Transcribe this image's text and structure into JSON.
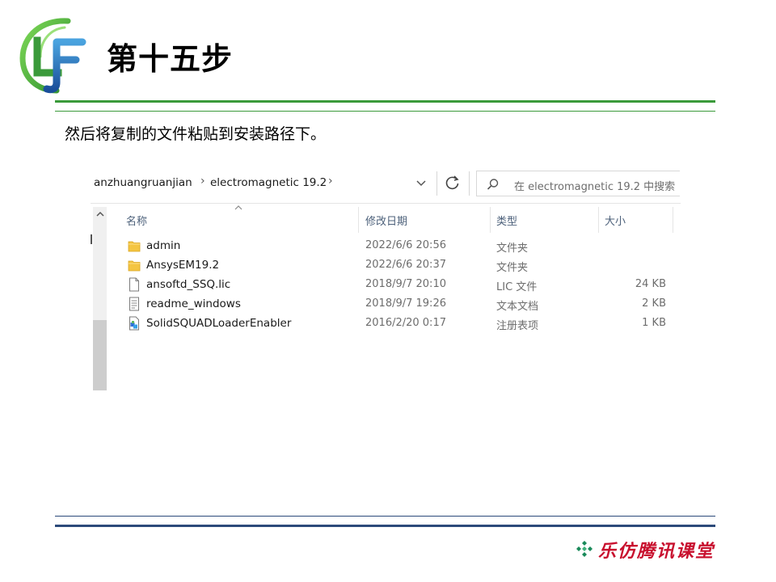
{
  "slide": {
    "logo_text": "LF",
    "title": "第十五步",
    "subtitle": "然后将复制的文件粘贴到安装路径下。"
  },
  "explorer": {
    "breadcrumbs": [
      "anzhuangruanjian",
      "electromagnetic 19.2"
    ],
    "search_placeholder": "在 electromagnetic 19.2 中搜索",
    "columns": {
      "name": "名称",
      "modified": "修改日期",
      "type": "类型",
      "size": "大小"
    },
    "files": [
      {
        "icon": "folder-icon",
        "name": "admin",
        "modified": "2022/6/6 20:56",
        "type": "文件夹",
        "size": ""
      },
      {
        "icon": "folder-icon",
        "name": "AnsysEM19.2",
        "modified": "2022/6/6 20:37",
        "type": "文件夹",
        "size": ""
      },
      {
        "icon": "document-icon",
        "name": "ansoftd_SSQ.lic",
        "modified": "2018/9/7 20:10",
        "type": "LIC 文件",
        "size": "24 KB"
      },
      {
        "icon": "text-document-icon",
        "name": "readme_windows",
        "modified": "2018/9/7 19:26",
        "type": "文本文档",
        "size": "2 KB"
      },
      {
        "icon": "registry-file-icon",
        "name": "SolidSQUADLoaderEnabler",
        "modified": "2016/2/20 0:17",
        "type": "注册表项",
        "size": "1 KB"
      }
    ]
  },
  "footer": {
    "brand": "乐仿腾讯课堂"
  },
  "colors": {
    "green_rule": "#3a9a3a",
    "blue_rule": "#2c4a7a",
    "brand_red": "#c8102e",
    "column_header": "#4c607a",
    "folder_yellow": "#f4c542"
  }
}
